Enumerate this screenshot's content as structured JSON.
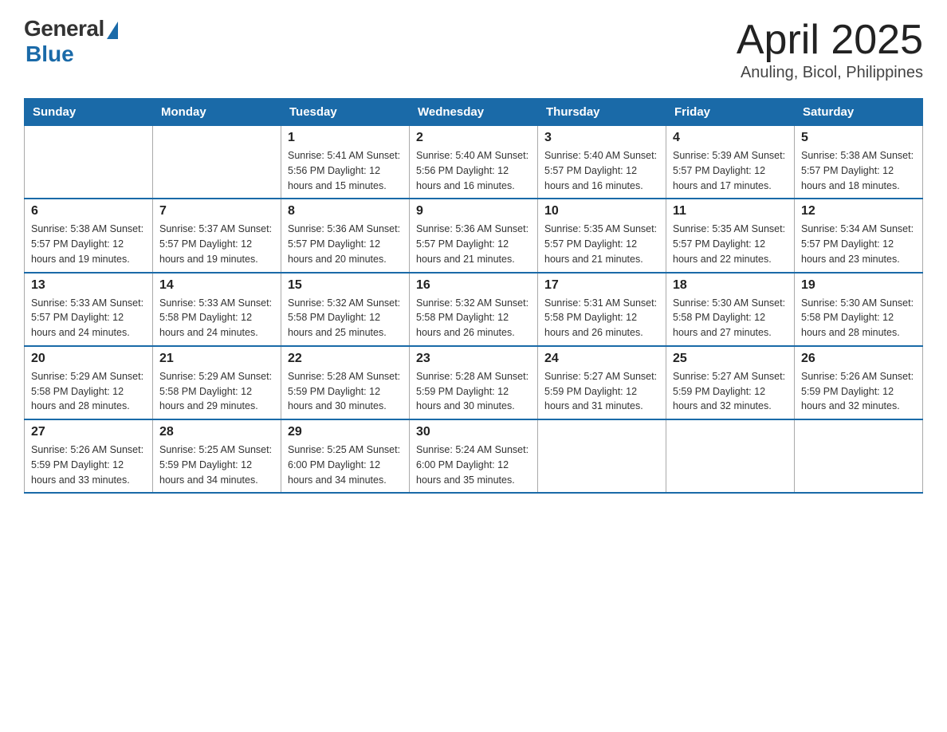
{
  "header": {
    "logo_general": "General",
    "logo_blue": "Blue",
    "title": "April 2025",
    "subtitle": "Anuling, Bicol, Philippines"
  },
  "calendar": {
    "days_of_week": [
      "Sunday",
      "Monday",
      "Tuesday",
      "Wednesday",
      "Thursday",
      "Friday",
      "Saturday"
    ],
    "weeks": [
      [
        {
          "day": "",
          "info": ""
        },
        {
          "day": "",
          "info": ""
        },
        {
          "day": "1",
          "info": "Sunrise: 5:41 AM\nSunset: 5:56 PM\nDaylight: 12 hours\nand 15 minutes."
        },
        {
          "day": "2",
          "info": "Sunrise: 5:40 AM\nSunset: 5:56 PM\nDaylight: 12 hours\nand 16 minutes."
        },
        {
          "day": "3",
          "info": "Sunrise: 5:40 AM\nSunset: 5:57 PM\nDaylight: 12 hours\nand 16 minutes."
        },
        {
          "day": "4",
          "info": "Sunrise: 5:39 AM\nSunset: 5:57 PM\nDaylight: 12 hours\nand 17 minutes."
        },
        {
          "day": "5",
          "info": "Sunrise: 5:38 AM\nSunset: 5:57 PM\nDaylight: 12 hours\nand 18 minutes."
        }
      ],
      [
        {
          "day": "6",
          "info": "Sunrise: 5:38 AM\nSunset: 5:57 PM\nDaylight: 12 hours\nand 19 minutes."
        },
        {
          "day": "7",
          "info": "Sunrise: 5:37 AM\nSunset: 5:57 PM\nDaylight: 12 hours\nand 19 minutes."
        },
        {
          "day": "8",
          "info": "Sunrise: 5:36 AM\nSunset: 5:57 PM\nDaylight: 12 hours\nand 20 minutes."
        },
        {
          "day": "9",
          "info": "Sunrise: 5:36 AM\nSunset: 5:57 PM\nDaylight: 12 hours\nand 21 minutes."
        },
        {
          "day": "10",
          "info": "Sunrise: 5:35 AM\nSunset: 5:57 PM\nDaylight: 12 hours\nand 21 minutes."
        },
        {
          "day": "11",
          "info": "Sunrise: 5:35 AM\nSunset: 5:57 PM\nDaylight: 12 hours\nand 22 minutes."
        },
        {
          "day": "12",
          "info": "Sunrise: 5:34 AM\nSunset: 5:57 PM\nDaylight: 12 hours\nand 23 minutes."
        }
      ],
      [
        {
          "day": "13",
          "info": "Sunrise: 5:33 AM\nSunset: 5:57 PM\nDaylight: 12 hours\nand 24 minutes."
        },
        {
          "day": "14",
          "info": "Sunrise: 5:33 AM\nSunset: 5:58 PM\nDaylight: 12 hours\nand 24 minutes."
        },
        {
          "day": "15",
          "info": "Sunrise: 5:32 AM\nSunset: 5:58 PM\nDaylight: 12 hours\nand 25 minutes."
        },
        {
          "day": "16",
          "info": "Sunrise: 5:32 AM\nSunset: 5:58 PM\nDaylight: 12 hours\nand 26 minutes."
        },
        {
          "day": "17",
          "info": "Sunrise: 5:31 AM\nSunset: 5:58 PM\nDaylight: 12 hours\nand 26 minutes."
        },
        {
          "day": "18",
          "info": "Sunrise: 5:30 AM\nSunset: 5:58 PM\nDaylight: 12 hours\nand 27 minutes."
        },
        {
          "day": "19",
          "info": "Sunrise: 5:30 AM\nSunset: 5:58 PM\nDaylight: 12 hours\nand 28 minutes."
        }
      ],
      [
        {
          "day": "20",
          "info": "Sunrise: 5:29 AM\nSunset: 5:58 PM\nDaylight: 12 hours\nand 28 minutes."
        },
        {
          "day": "21",
          "info": "Sunrise: 5:29 AM\nSunset: 5:58 PM\nDaylight: 12 hours\nand 29 minutes."
        },
        {
          "day": "22",
          "info": "Sunrise: 5:28 AM\nSunset: 5:59 PM\nDaylight: 12 hours\nand 30 minutes."
        },
        {
          "day": "23",
          "info": "Sunrise: 5:28 AM\nSunset: 5:59 PM\nDaylight: 12 hours\nand 30 minutes."
        },
        {
          "day": "24",
          "info": "Sunrise: 5:27 AM\nSunset: 5:59 PM\nDaylight: 12 hours\nand 31 minutes."
        },
        {
          "day": "25",
          "info": "Sunrise: 5:27 AM\nSunset: 5:59 PM\nDaylight: 12 hours\nand 32 minutes."
        },
        {
          "day": "26",
          "info": "Sunrise: 5:26 AM\nSunset: 5:59 PM\nDaylight: 12 hours\nand 32 minutes."
        }
      ],
      [
        {
          "day": "27",
          "info": "Sunrise: 5:26 AM\nSunset: 5:59 PM\nDaylight: 12 hours\nand 33 minutes."
        },
        {
          "day": "28",
          "info": "Sunrise: 5:25 AM\nSunset: 5:59 PM\nDaylight: 12 hours\nand 34 minutes."
        },
        {
          "day": "29",
          "info": "Sunrise: 5:25 AM\nSunset: 6:00 PM\nDaylight: 12 hours\nand 34 minutes."
        },
        {
          "day": "30",
          "info": "Sunrise: 5:24 AM\nSunset: 6:00 PM\nDaylight: 12 hours\nand 35 minutes."
        },
        {
          "day": "",
          "info": ""
        },
        {
          "day": "",
          "info": ""
        },
        {
          "day": "",
          "info": ""
        }
      ]
    ]
  }
}
